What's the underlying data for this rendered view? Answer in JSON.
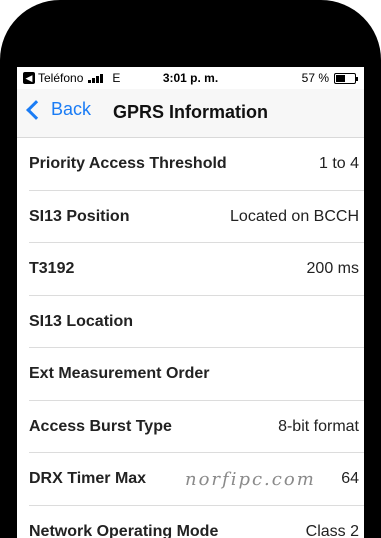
{
  "status_bar": {
    "carrier": "Teléfono",
    "network": "E",
    "time": "3:01 p. m.",
    "battery_percent": "57 %",
    "battery_level": 0.57
  },
  "nav": {
    "back_label": "Back",
    "title": "GPRS Information"
  },
  "rows": [
    {
      "label": "Priority Access Threshold",
      "value": "1 to 4"
    },
    {
      "label": "SI13 Position",
      "value": "Located on BCCH"
    },
    {
      "label": "T3192",
      "value": "200 ms"
    },
    {
      "label": "SI13 Location",
      "value": ""
    },
    {
      "label": "Ext Measurement Order",
      "value": ""
    },
    {
      "label": "Access Burst Type",
      "value": "8-bit format"
    },
    {
      "label": "DRX Timer Max",
      "value": "64"
    },
    {
      "label": "Network Operating Mode",
      "value": "Class 2"
    }
  ],
  "watermark": "norfipc.com"
}
